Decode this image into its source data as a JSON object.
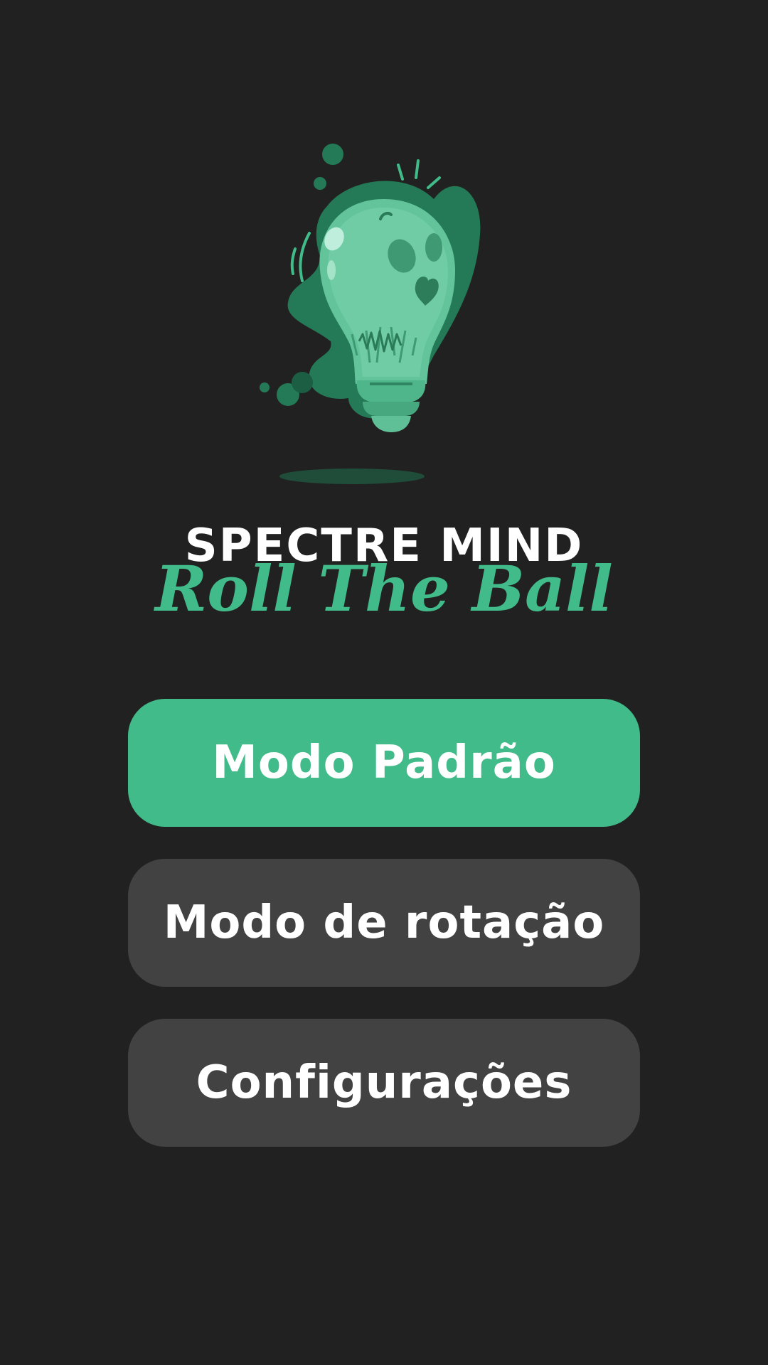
{
  "brand": {
    "title": "SPECTRE MIND",
    "subtitle": "Roll The Ball",
    "logo_icon": "lightbulb-icon"
  },
  "menu": {
    "standard_mode_label": "Modo Padrão",
    "rotation_mode_label": "Modo de rotação",
    "settings_label": "Configurações"
  },
  "colors": {
    "background": "#212121",
    "accent": "#41bb89",
    "secondary_button": "#424242",
    "text": "#ffffff"
  }
}
